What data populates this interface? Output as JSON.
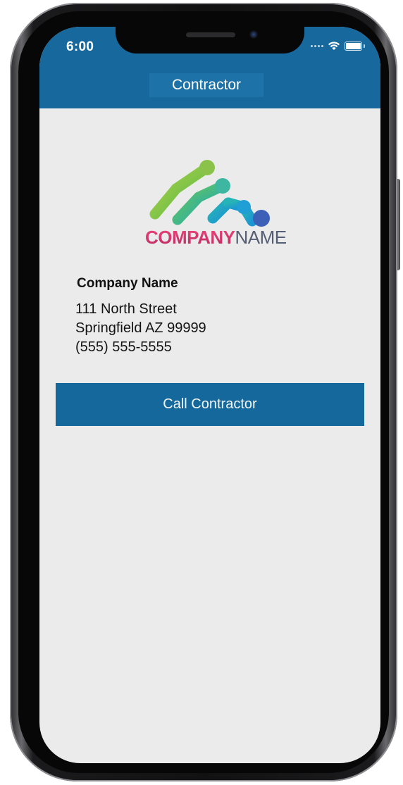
{
  "status_bar": {
    "time": "6:00",
    "icons": [
      "cellular-signal-icon",
      "wifi-icon",
      "battery-icon"
    ]
  },
  "nav": {
    "title": "Contractor"
  },
  "logo": {
    "company": "COMPANY",
    "name": "NAME",
    "colors": [
      "#8bc34a",
      "#3db7a1",
      "#1f9fd6",
      "#3c5fb8",
      "#e1497a"
    ]
  },
  "contractor": {
    "name": "Company Name",
    "street": "111 North Street",
    "city_line": "Springfield AZ 99999",
    "phone": "(555) 555-5555"
  },
  "actions": {
    "call_label": "Call Contractor"
  },
  "colors": {
    "header_bg": "#17689c",
    "button_bg": "#15689c",
    "screen_bg": "#ebebeb"
  }
}
